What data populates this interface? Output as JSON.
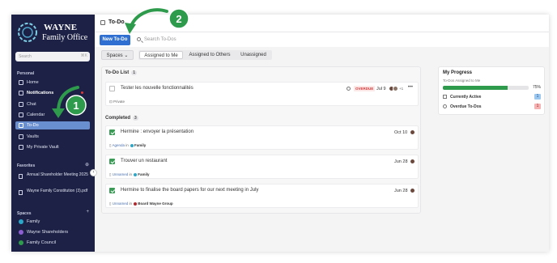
{
  "sidebar": {
    "logo_line1": "WAYNE",
    "logo_line2": "Family Office",
    "search_placeholder": "Search",
    "search_shortcut": "⌘K",
    "section_personal": "Personal",
    "personal_items": [
      {
        "label": "Home",
        "icon": "home-icon"
      },
      {
        "label": "Notifications",
        "icon": "bell-icon"
      },
      {
        "label": "Chat",
        "icon": "chat-icon"
      },
      {
        "label": "Calendar",
        "icon": "calendar-icon"
      },
      {
        "label": "To-Do",
        "icon": "checkbox-icon"
      },
      {
        "label": "Vaults",
        "icon": "vault-icon"
      },
      {
        "label": "My Private Vault",
        "icon": "lock-icon"
      }
    ],
    "section_favorites": "Favorites",
    "favorites": [
      {
        "label": "Annual Shareholder Meeting 2025",
        "icon": "calendar-icon"
      },
      {
        "label": "Wayne Family Constitution (3).pdf",
        "icon": "file-icon"
      }
    ],
    "section_spaces": "Spaces",
    "spaces": [
      {
        "label": "Family",
        "color": "#2aa7c9"
      },
      {
        "label": "Wayne Shareholders",
        "color": "#8d5fd3"
      },
      {
        "label": "Family Council",
        "color": "#2e9a4c"
      }
    ]
  },
  "header": {
    "title": "To-Do"
  },
  "toolbar": {
    "new_label": "New To-Do",
    "search_placeholder": "Search To-Dos"
  },
  "filters": {
    "spaces_label": "Spaces",
    "tabs": [
      "Assigned to Me",
      "Assigned to Others",
      "Unassigned"
    ],
    "active_tab": "Assigned to Me"
  },
  "todo_list": {
    "heading": "To-Do List",
    "count": "1",
    "items": [
      {
        "title": "Tester les nouvelle fonctionnalités",
        "status": "OVERDUE",
        "date": "Jul 9",
        "extra_assignees": "+1",
        "visibility": "Private"
      }
    ]
  },
  "completed": {
    "heading": "Completed",
    "count": "3",
    "items": [
      {
        "title": "Hermine : envoyer la présentation",
        "date": "Oct 10",
        "page": "Agenda",
        "connector": "in",
        "space": "Family",
        "space_color": "#2aa7c9"
      },
      {
        "title": "Trouver un restaurant",
        "date": "Jun 28",
        "page": "Unnamed",
        "connector": "in",
        "space": "Family",
        "space_color": "#2aa7c9"
      },
      {
        "title": "Hermine to finalise the board papers for our next meeting in July",
        "date": "Jun 28",
        "page": "Unnamed",
        "connector": "in",
        "space": "Board Wayne Group",
        "space_color": "#b3262e"
      }
    ]
  },
  "progress": {
    "title": "My Progress",
    "subtitle": "To-Dos Assigned to Me",
    "percent_label": "75%",
    "percent_value": 75,
    "currently_active_label": "Currently Active",
    "currently_active_count": "1",
    "overdue_label": "Overdue To-Dos",
    "overdue_count": "1"
  },
  "annotations": {
    "step1": "1",
    "step2": "2"
  },
  "colors": {
    "sidebar_bg": "#1c2145",
    "accent": "#2f6fd1",
    "annotation": "#2e9a4c",
    "overdue": "#d33b3b"
  }
}
